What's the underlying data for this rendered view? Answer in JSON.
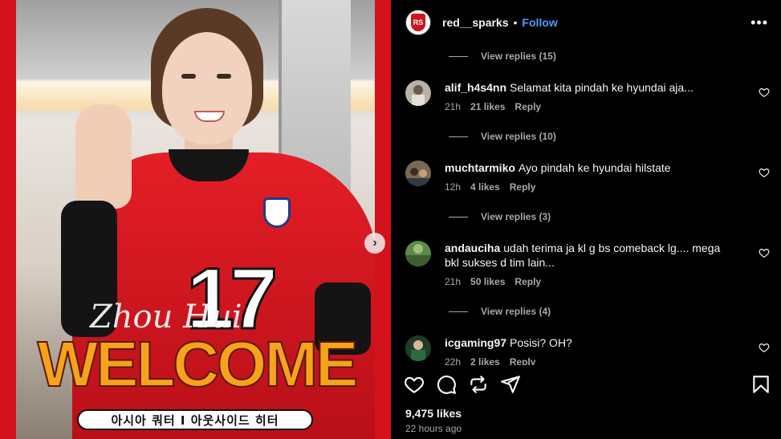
{
  "post": {
    "username": "red__sparks",
    "follow_label": "Follow",
    "more_label": "•••",
    "media": {
      "signature": "Zhou Hui",
      "headline": "WELCOME",
      "position_caption": "아시아 쿼터 I 아웃사이드 히터",
      "jersey_number": "17",
      "badge_text": "RS",
      "next_glyph": "›"
    }
  },
  "comments": [
    {
      "replies_label": "View replies (15)"
    },
    {
      "username": "alif_h4s4nn",
      "text": "Selamat kita pindah ke hyundai aja...",
      "time": "21h",
      "likes": "21 likes",
      "reply_label": "Reply",
      "replies_label": "View replies (10)"
    },
    {
      "username": "muchtarmiko",
      "text": "Ayo pindah ke hyundai hilstate",
      "time": "12h",
      "likes": "4 likes",
      "reply_label": "Reply",
      "replies_label": "View replies (3)"
    },
    {
      "username": "andauciha",
      "text": "udah terima ja kl g bs comeback lg.... mega bkl sukses d tim lain...",
      "time": "21h",
      "likes": "50 likes",
      "reply_label": "Reply",
      "replies_label": "View replies (4)"
    },
    {
      "username": "icgaming97",
      "text": "Posisi? OH?",
      "time": "22h",
      "likes": "2 likes",
      "reply_label": "Reply"
    }
  ],
  "footer": {
    "likes_total": "9,475 likes",
    "posted": "22 hours ago"
  },
  "icons": {
    "like": "heart-icon",
    "comment": "comment-bubble-icon",
    "repost": "repost-icon",
    "share": "send-icon",
    "save": "bookmark-icon"
  }
}
